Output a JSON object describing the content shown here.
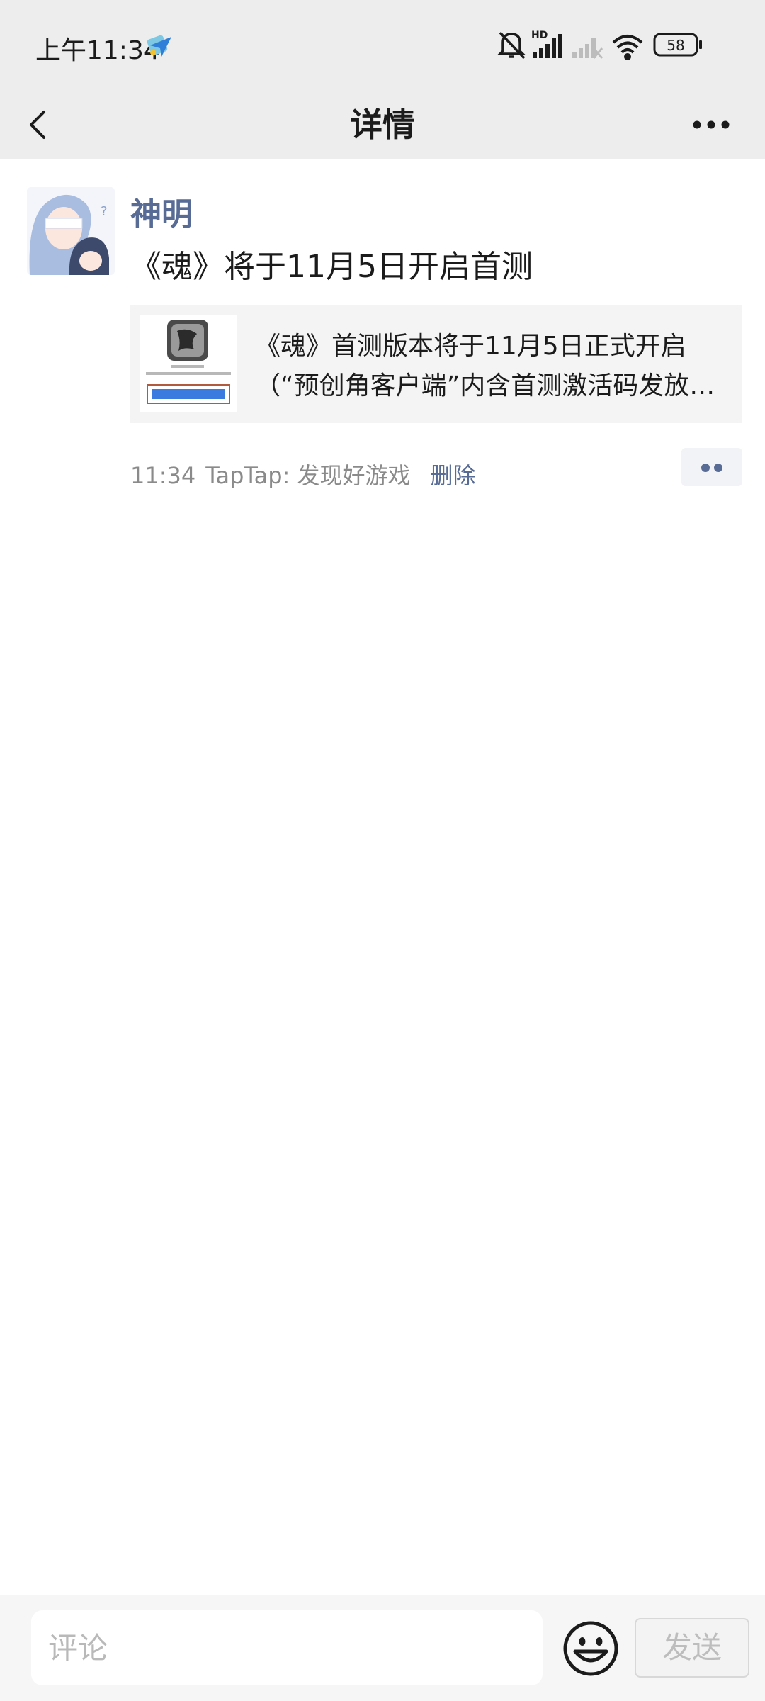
{
  "status_bar": {
    "time": "上午11:34",
    "hd_label": "HD",
    "battery_level": "58"
  },
  "header": {
    "title": "详情"
  },
  "post": {
    "author": "神明",
    "text": "《魂》将于11月5日开启首测",
    "share_card": {
      "title_line1": "《魂》首测版本将于11月5日正式开启",
      "title_line2": "（“预创角客户端”内含首测激活码发放…"
    },
    "meta": {
      "time": "11:34",
      "source": "TapTap: 发现好游戏",
      "delete_label": "删除"
    }
  },
  "comment_bar": {
    "placeholder": "评论",
    "send_label": "发送"
  },
  "colors": {
    "link_blue": "#576b95",
    "header_bg": "#ededed"
  },
  "icons": [
    "app-notification-icon",
    "mute-icon",
    "signal-icon",
    "wifi-icon",
    "battery-icon",
    "back-icon",
    "more-icon",
    "emoji-icon"
  ]
}
